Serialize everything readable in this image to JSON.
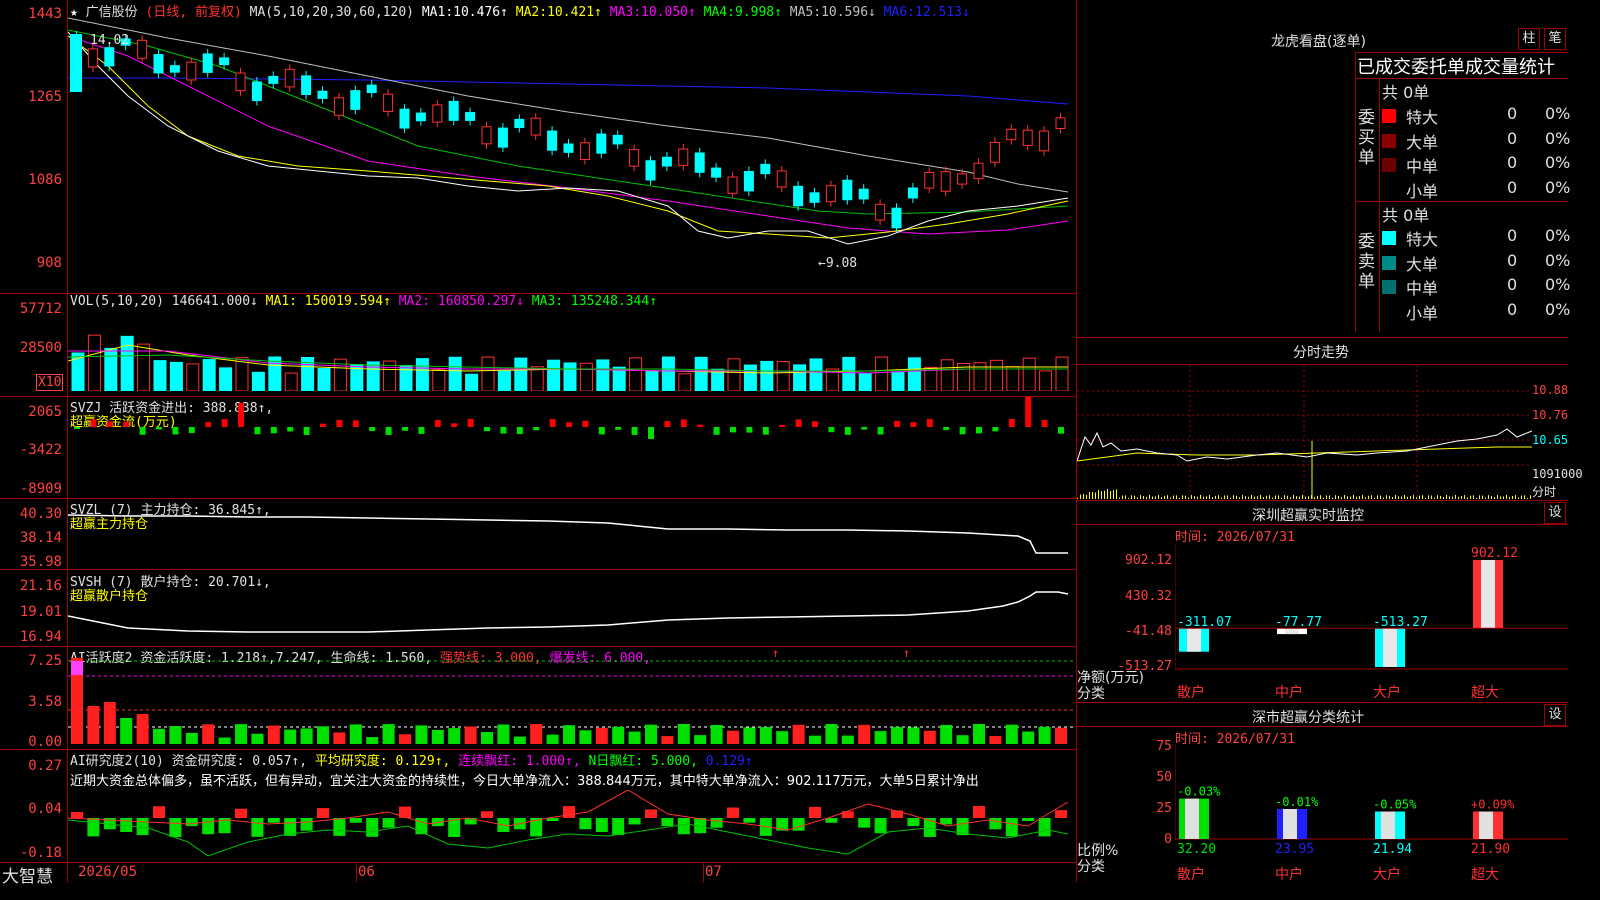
{
  "main": {
    "stock_name": "广信股份",
    "mode": "(日线, 前复权)",
    "ma_label": "MA(5,10,20,30,60,120)",
    "ma": [
      {
        "label": "MA1:",
        "value": "10.476↑",
        "color": "#ffffff"
      },
      {
        "label": "MA2:",
        "value": "10.421↑",
        "color": "#ffff00"
      },
      {
        "label": "MA3:",
        "value": "10.050↑",
        "color": "#ff00ff"
      },
      {
        "label": "MA4:",
        "value": "9.998↑",
        "color": "#00ff00"
      },
      {
        "label": "MA5:",
        "value": "10.596↓",
        "color": "#c0c0c0"
      },
      {
        "label": "MA6:",
        "value": "12.513↓",
        "color": "#2020ff"
      }
    ],
    "yticks": [
      "1443",
      "1265",
      "1086",
      "908"
    ],
    "high_mark": "14.02",
    "low_mark": "←9.08"
  },
  "vol": {
    "header": "VOL(5,10,20)",
    "value": "146641.000↓",
    "ma1": "MA1: 150019.594↑",
    "ma2": "MA2: 160850.297↓",
    "ma3": "MA3: 135248.344↑",
    "yticks": [
      "57712",
      "28500"
    ],
    "unit": "X10"
  },
  "svzj": {
    "header": "SVZJ",
    "line": "活跃资金进出: 388.838↑,",
    "sub": "超赢资金流(万元)",
    "yticks": [
      "2065",
      "-3422",
      "-8909"
    ]
  },
  "svzl": {
    "header": "SVZL (7)",
    "line": "主力持仓: 36.845↑,",
    "sub": "超赢主力持仓",
    "yticks": [
      "40.30",
      "38.14",
      "35.98"
    ]
  },
  "svsh": {
    "header": "SVSH (7)",
    "line": "散户持仓: 20.701↓,",
    "sub": "超赢散户持仓",
    "yticks": [
      "21.16",
      "19.01",
      "16.94"
    ]
  },
  "ai1": {
    "header": "AI活跃度2",
    "a": "资金活跃度: 1.218↑,7.247,",
    "b": "生命线: 1.560,",
    "c": "强势线: 3.000,",
    "d": "爆发线: 6.000,",
    "yticks": [
      "7.25",
      "3.58",
      "0.00"
    ]
  },
  "ai2": {
    "header": "AI研究度2(10)",
    "a": "资金研究度: 0.057↑,",
    "b": "平均研究度: 0.129↑,",
    "c": "连续飘红: 1.000↑,",
    "d": "N日飘红: 5.000,",
    "e": "0.129↑",
    "summary": "近期大资金总体偏多，虽不活跃，但有异动，宜关注大资金的持续性，今日大单净流入：388.844万元，其中特大单净流入：902.117万元，大单5日累计净出",
    "yticks": [
      "0.27",
      "0.04",
      "-0.18"
    ]
  },
  "xaxis": {
    "brand": "大智慧",
    "labels": [
      "2026/05",
      "06",
      "07"
    ]
  },
  "right": {
    "lhb_title": "龙虎看盘(逐单)",
    "btn_zhu": "柱",
    "btn_bi": "笔",
    "stat_title": "已成交委托单成交量统计",
    "buy_group": "委买单",
    "sell_group": "委卖单",
    "buy_total": "共 0单",
    "sell_total": "共 0单",
    "buy_rows": [
      {
        "name": "特大",
        "count": "0",
        "pct": "0%",
        "color": "#ff0000"
      },
      {
        "name": "大单",
        "count": "0",
        "pct": "0%",
        "color": "#8b0000"
      },
      {
        "name": "中单",
        "count": "0",
        "pct": "0%",
        "color": "#6a0000"
      },
      {
        "name": "小单",
        "count": "0",
        "pct": "0%",
        "color": "#000000"
      }
    ],
    "sell_rows": [
      {
        "name": "特大",
        "count": "0",
        "pct": "0%",
        "color": "#00ffff"
      },
      {
        "name": "大单",
        "count": "0",
        "pct": "0%",
        "color": "#008b8b"
      },
      {
        "name": "中单",
        "count": "0",
        "pct": "0%",
        "color": "#007070"
      },
      {
        "name": "小单",
        "count": "0",
        "pct": "0%",
        "color": "#000000"
      }
    ],
    "fenshi_title": "分时走势",
    "fenshi_yticks": [
      "10.88",
      "10.76",
      "10.65",
      "1091000",
      "分时"
    ],
    "monitor_title": "深圳超赢实时监控",
    "monitor_btn": "设",
    "monitor_time": "时间: 2026/07/31",
    "monitor_yticks": [
      "902.12",
      "430.32",
      "-41.48",
      "-513.27"
    ],
    "monitor_ylabel": "净额(万元)",
    "monitor_xlabel": "分类",
    "monitor_values": [
      -311.07,
      -77.77,
      -513.27,
      902.12
    ],
    "monitor_value_labels": [
      "-311.07",
      "-77.77",
      "-513.27",
      "902.12"
    ],
    "monitor_categories": [
      "散户",
      "中户",
      "大户",
      "超大"
    ],
    "class_title": "深市超赢分类统计",
    "class_btn": "设",
    "class_time": "时间: 2026/07/31",
    "class_yticks": [
      "75",
      "50",
      "25",
      "0"
    ],
    "class_ylabel": "比例%",
    "class_xlabel": "分类",
    "class_values": [
      32.2,
      23.95,
      21.94,
      21.9
    ],
    "class_value_labels": [
      "32.20",
      "23.95",
      "21.94",
      "21.90"
    ],
    "class_changes": [
      "-0.03%",
      "-0.01%",
      "-0.05%",
      "+0.09%"
    ],
    "class_categories": [
      "散户",
      "中户",
      "大户",
      "超大"
    ]
  }
}
